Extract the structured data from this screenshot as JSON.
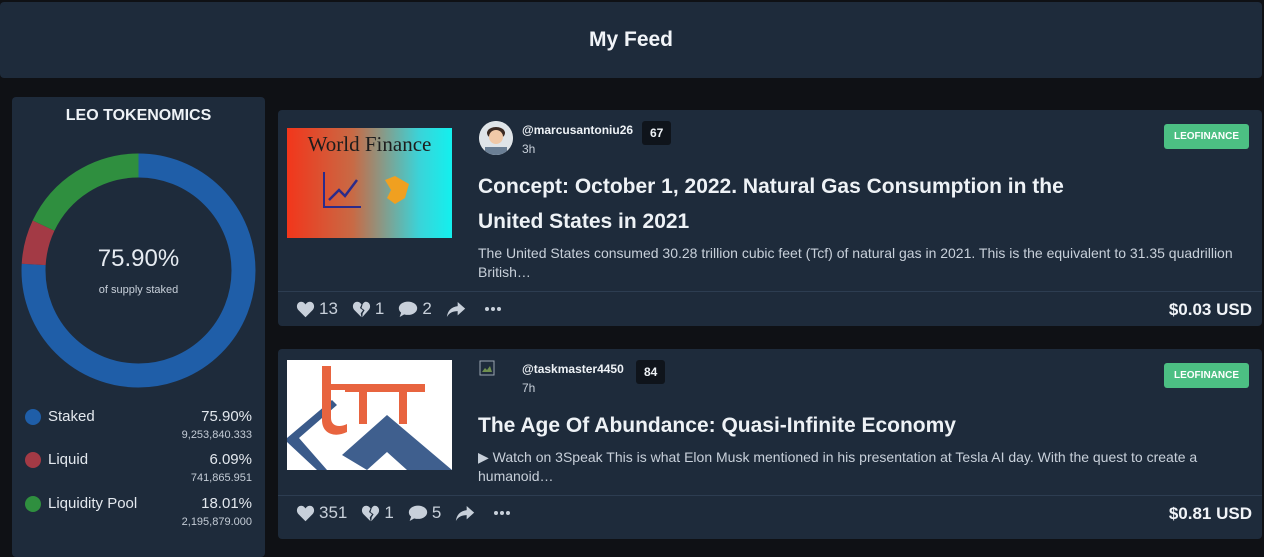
{
  "header": {
    "title": "My Feed"
  },
  "tokenomics": {
    "title": "LEO TOKENOMICS",
    "center_value": "75.90%",
    "center_label": "of supply staked",
    "segments": [
      {
        "name": "Staked",
        "percent_label": "75.90%",
        "amount": "9,253,840.333",
        "value": 75.9,
        "color": "#1f5ea8"
      },
      {
        "name": "Liquid",
        "percent_label": "6.09%",
        "amount": "741,865.951",
        "value": 6.09,
        "color": "#a33a45"
      },
      {
        "name": "Liquidity Pool",
        "percent_label": "18.01%",
        "amount": "2,195,879.000",
        "value": 18.01,
        "color": "#2f8f3f"
      }
    ]
  },
  "posts": [
    {
      "thumb_text": "World Finance",
      "author": "@marcusantoniu26",
      "reputation": "67",
      "time_ago": "3h",
      "tag": "LEOFINANCE",
      "title": "Concept: October 1, 2022. Natural Gas Consumption in the United States in 2021",
      "excerpt": "The United States consumed 30.28 trillion cubic feet (Tcf) of natural gas in 2021. This is the equivalent to 31.35 quadrillion British…",
      "upvotes": "13",
      "downvotes": "1",
      "comments": "2",
      "payout": "$0.03 USD"
    },
    {
      "thumb_text": "",
      "author": "@taskmaster4450",
      "reputation": "84",
      "time_ago": "7h",
      "tag": "LEOFINANCE",
      "title": "The Age Of Abundance: Quasi-Infinite Economy",
      "excerpt": "▶ Watch on 3Speak This is what Elon Musk mentioned in his presentation at Tesla AI day. With the quest to create a humanoid…",
      "upvotes": "351",
      "downvotes": "1",
      "comments": "5",
      "payout": "$0.81 USD"
    }
  ]
}
